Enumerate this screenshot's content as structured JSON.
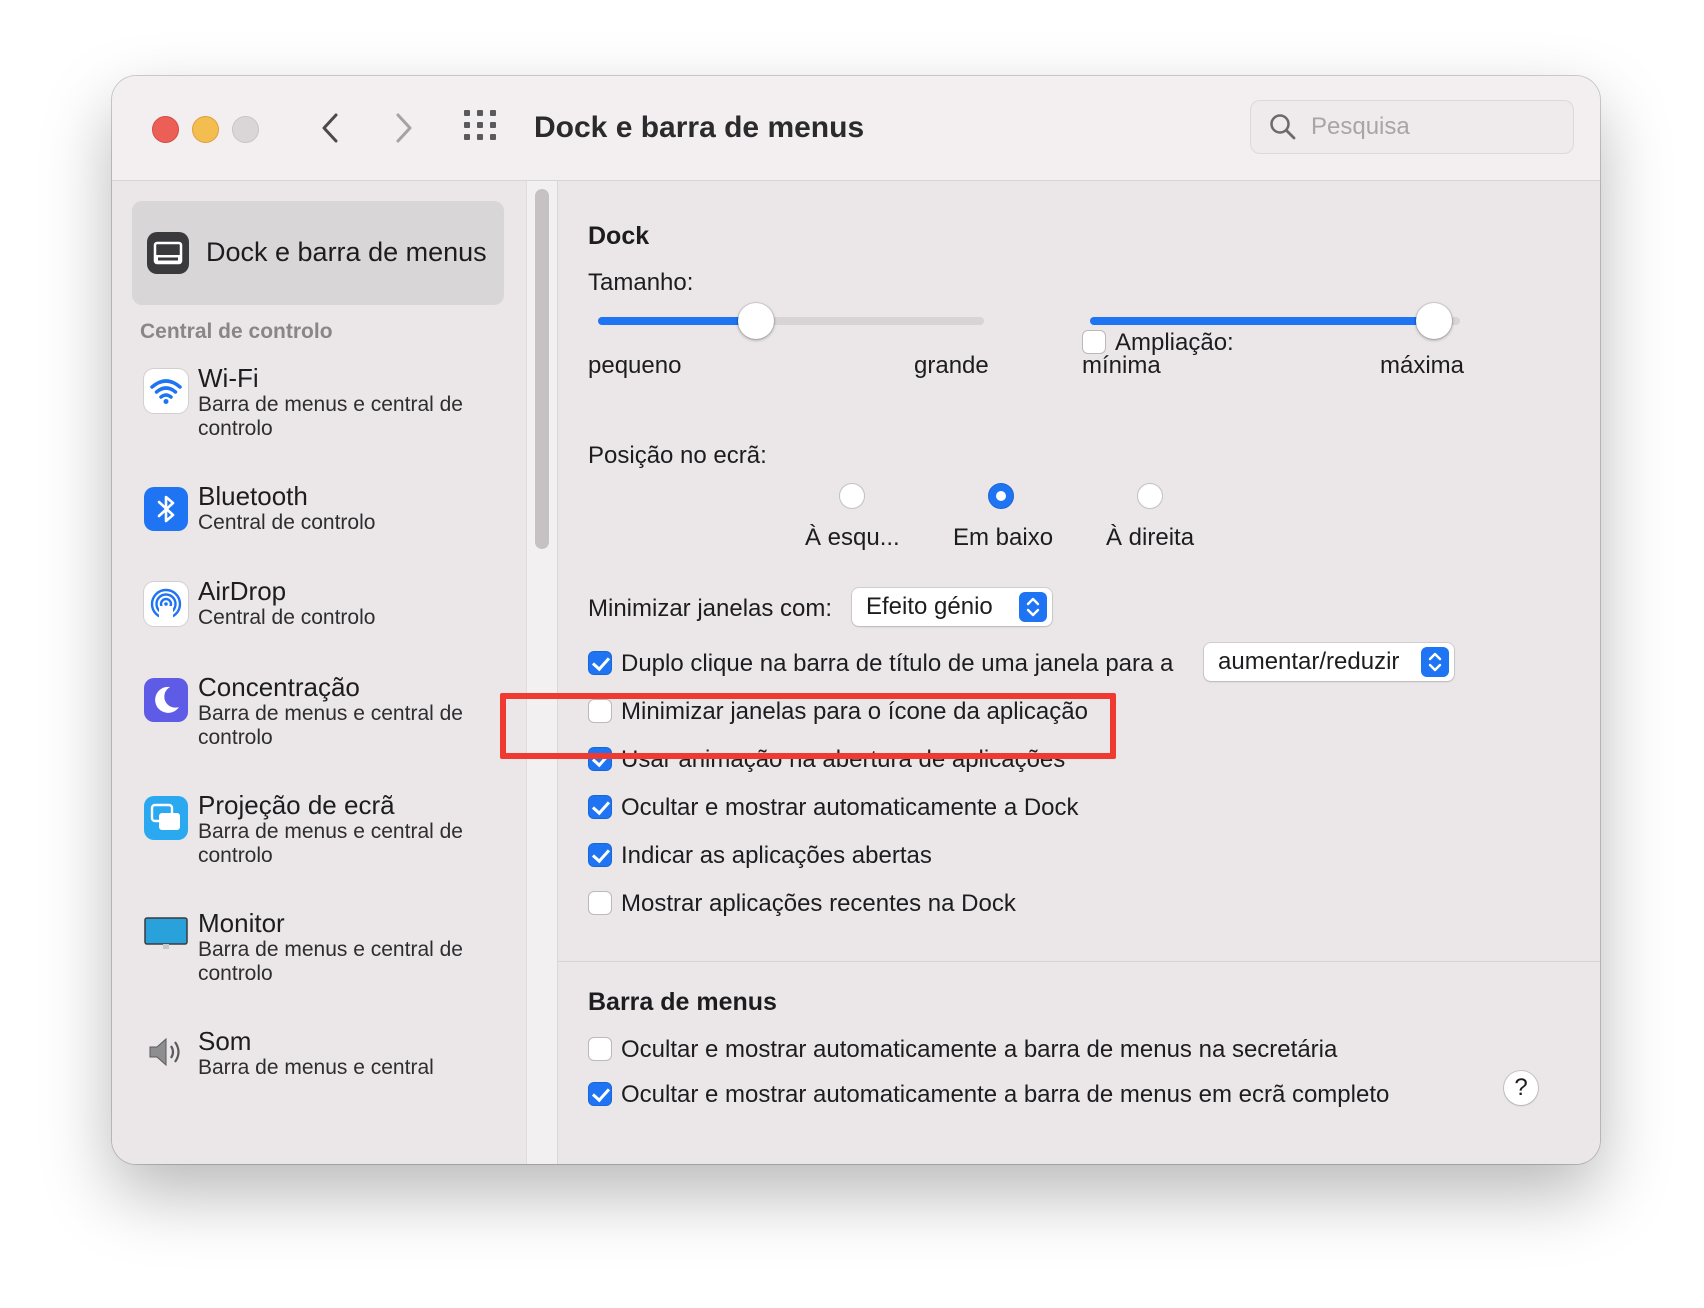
{
  "window": {
    "title": "Dock e barra de menus",
    "search_placeholder": "Pesquisa"
  },
  "sidebar": {
    "selected_label": "Dock e barra de menus",
    "section_header": "Central de controlo",
    "items": [
      {
        "name": "Wi-Fi",
        "sub": "Barra de menus e central de controlo",
        "icon": "wifi-icon"
      },
      {
        "name": "Bluetooth",
        "sub": "Central de controlo",
        "icon": "bluetooth-icon"
      },
      {
        "name": "AirDrop",
        "sub": "Central de controlo",
        "icon": "airdrop-icon"
      },
      {
        "name": "Concentração",
        "sub": "Barra de menus e central de controlo",
        "icon": "moon-icon"
      },
      {
        "name": "Projeção de ecrã",
        "sub": "Barra de menus e central de controlo",
        "icon": "screen-mirroring-icon"
      },
      {
        "name": "Monitor",
        "sub": "Barra de menus e central de controlo",
        "icon": "monitor-icon"
      },
      {
        "name": "Som",
        "sub": "Barra de menus e central",
        "icon": "speaker-icon"
      }
    ]
  },
  "dock": {
    "header": "Dock",
    "size_label": "Tamanho:",
    "size_min": "pequeno",
    "size_max": "grande",
    "size_value_fraction": 0.41,
    "magnification_label": "Ampliação:",
    "magnification_checked": false,
    "mag_min": "mínima",
    "mag_max": "máxima",
    "mag_value_fraction": 0.93,
    "position_label": "Posição no ecrã:",
    "position_options": [
      "À esqu...",
      "Em baixo",
      "À direita"
    ],
    "position_selected": "Em baixo",
    "minimize_label": "Minimizar janelas com:",
    "minimize_value": "Efeito génio",
    "double_click_label": "Duplo clique na barra de título de uma janela para a",
    "double_click_value": "aumentar/reduzir",
    "double_click_checked": true,
    "options": [
      {
        "label": "Minimizar janelas para o ícone da aplicação",
        "checked": false
      },
      {
        "label": "Usar animação na abertura de aplicações",
        "checked": true
      },
      {
        "label": "Ocultar e mostrar automaticamente a Dock",
        "checked": true
      },
      {
        "label": "Indicar as aplicações abertas",
        "checked": true
      },
      {
        "label": "Mostrar aplicações recentes na Dock",
        "checked": false
      }
    ]
  },
  "menubar": {
    "header": "Barra de menus",
    "options": [
      {
        "label": "Ocultar e mostrar automaticamente a barra de menus na secretária",
        "checked": false
      },
      {
        "label": "Ocultar e mostrar automaticamente a barra de menus em ecrã completo",
        "checked": true
      }
    ],
    "help": "?"
  },
  "colors": {
    "accent": "#1e74f3",
    "highlight": "#ef3a31"
  }
}
